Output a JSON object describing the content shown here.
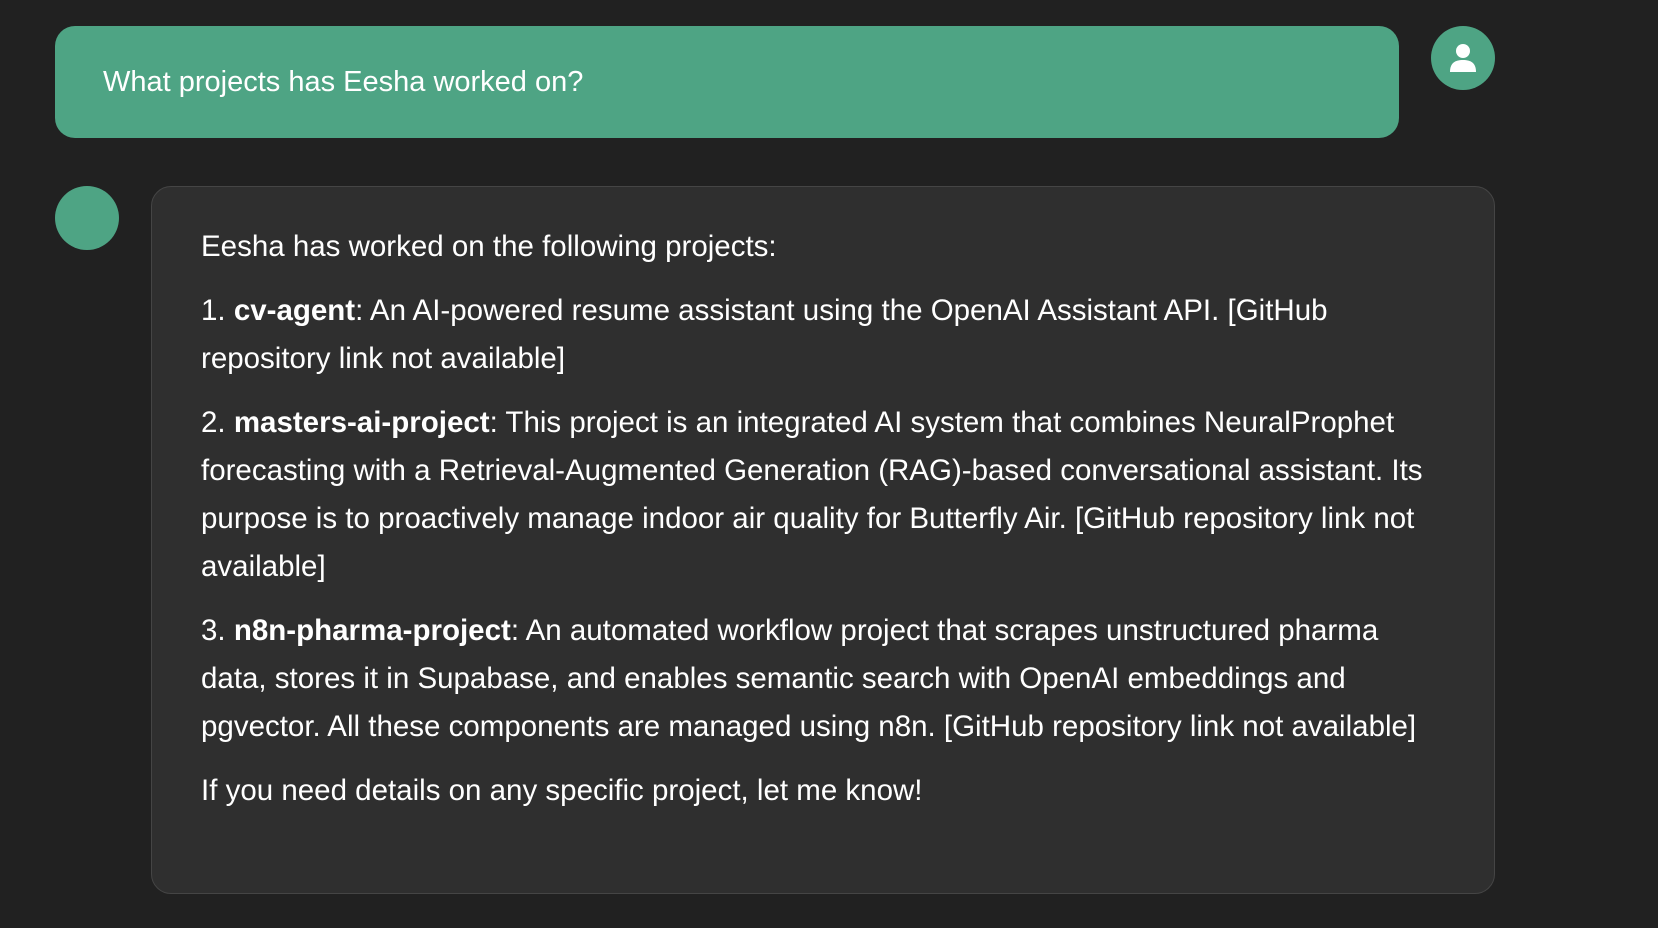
{
  "conversation": {
    "user_message": {
      "text": "What projects has Eesha worked on?",
      "avatar_icon": "user-icon"
    },
    "assistant_message": {
      "intro": "Eesha has worked on the following projects:",
      "projects": [
        {
          "number": "1.",
          "name": "cv-agent",
          "description": ": An AI-powered resume assistant using the OpenAI Assistant API. [GitHub repository link not available]"
        },
        {
          "number": "2.",
          "name": "masters-ai-project",
          "description": ": This project is an integrated AI system that combines NeuralProphet forecasting with a Retrieval-Augmented Generation (RAG)-based conversational assistant. Its purpose is to proactively manage indoor air quality for Butterfly Air. [GitHub repository link not available]"
        },
        {
          "number": "3.",
          "name": "n8n-pharma-project",
          "description": ": An automated workflow project that scrapes unstructured pharma data, stores it in Supabase, and enables semantic search with OpenAI embeddings and pgvector. All these components are managed using n8n. [GitHub repository link not available]"
        }
      ],
      "closing": "If you need details on any specific project, let me know!"
    }
  },
  "colors": {
    "background": "#212121",
    "accent": "#4ea484",
    "assistant_bubble": "#2f2f2f",
    "assistant_border": "#454545",
    "text": "#ffffff"
  }
}
